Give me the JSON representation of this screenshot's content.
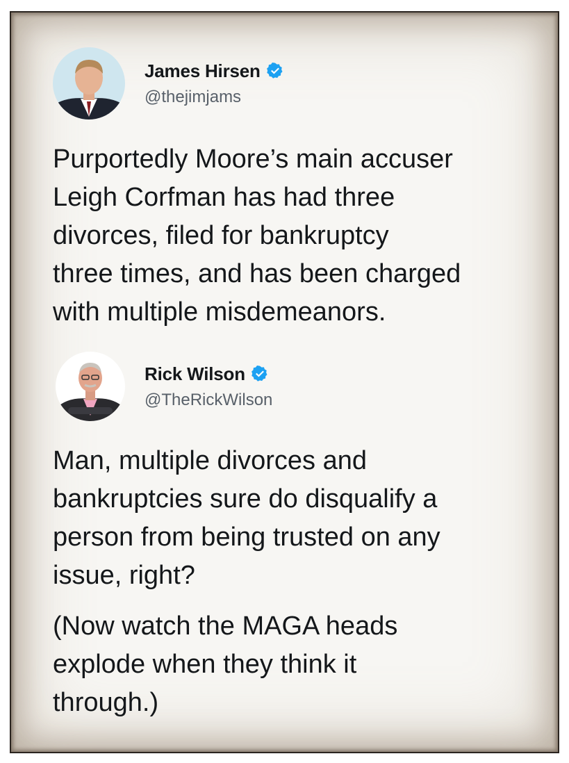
{
  "tweet1": {
    "display_name": "James Hirsen",
    "handle": "@thejimjams",
    "verified": true,
    "avatar_icon": "profile-photo",
    "text": "Purportedly Moore’s main accuser\nLeigh Corfman has had three\ndivorces, filed for bankruptcy\nthree times, and has been charged\nwith multiple misdemeanors."
  },
  "tweet2": {
    "display_name": "Rick Wilson",
    "handle": "@TheRickWilson",
    "verified": true,
    "avatar_icon": "profile-photo",
    "text_paragraph_1": "Man, multiple divorces and\nbankruptcies sure do disqualify a\nperson from being trusted on any\nissue, right?",
    "text_paragraph_2": "(Now watch the MAGA heads\nexplode when they think it\nthrough.)"
  },
  "colors": {
    "verified_badge": "#1da1f2",
    "text": "#14171a",
    "handle": "#586069",
    "paper": "#f7f6f3"
  }
}
